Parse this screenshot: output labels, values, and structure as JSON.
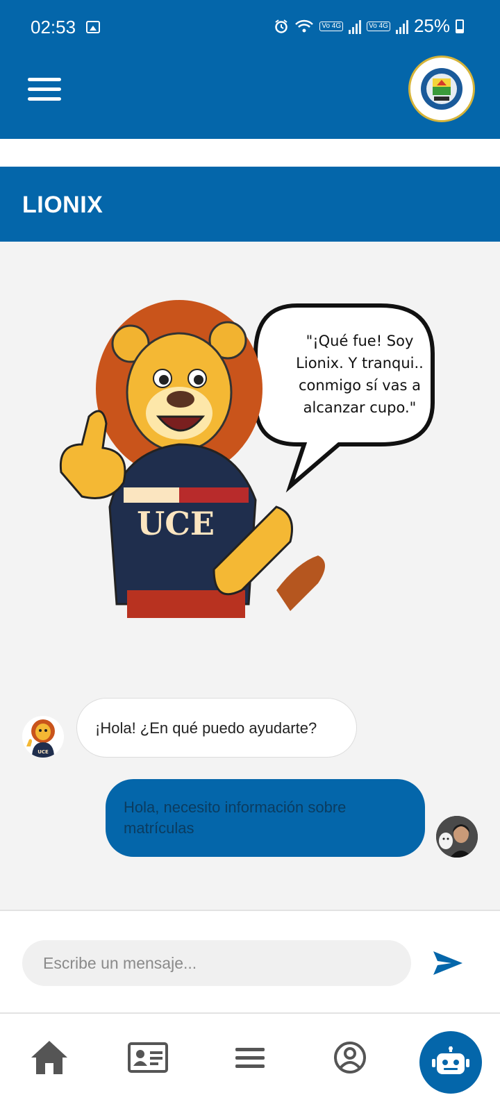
{
  "status_bar": {
    "time": "02:53",
    "battery": "25%",
    "network_badge_1": "Vo 4G",
    "network_badge_2": "Vo 4G"
  },
  "app_bar": {
    "menu_icon": "hamburger-icon",
    "logo": "university-seal"
  },
  "page": {
    "title": "LIONIX"
  },
  "hero": {
    "speech_lines": [
      "\"¡Qué fue! Soy",
      "Lionix. Y tranqui..",
      "conmigo sí vas a",
      "alcanzar cupo.\""
    ],
    "shirt_text": "UCE"
  },
  "chat": {
    "messages": [
      {
        "sender": "bot",
        "text": "¡Hola! ¿En qué puedo ayudarte?"
      },
      {
        "sender": "user",
        "text": "Hola, necesito información sobre matrículas"
      }
    ]
  },
  "composer": {
    "placeholder": "Escribe un mensaje...",
    "send_icon": "send-icon"
  },
  "bottom_nav": {
    "items": [
      {
        "icon": "home-icon"
      },
      {
        "icon": "id-card-icon"
      },
      {
        "icon": "menu-icon"
      },
      {
        "icon": "profile-icon"
      },
      {
        "icon": "robot-icon",
        "active": true
      }
    ]
  },
  "colors": {
    "primary": "#0466aa",
    "background": "#f3f3f3",
    "bubble_bot": "#ffffff",
    "bubble_user": "#0466aa"
  }
}
